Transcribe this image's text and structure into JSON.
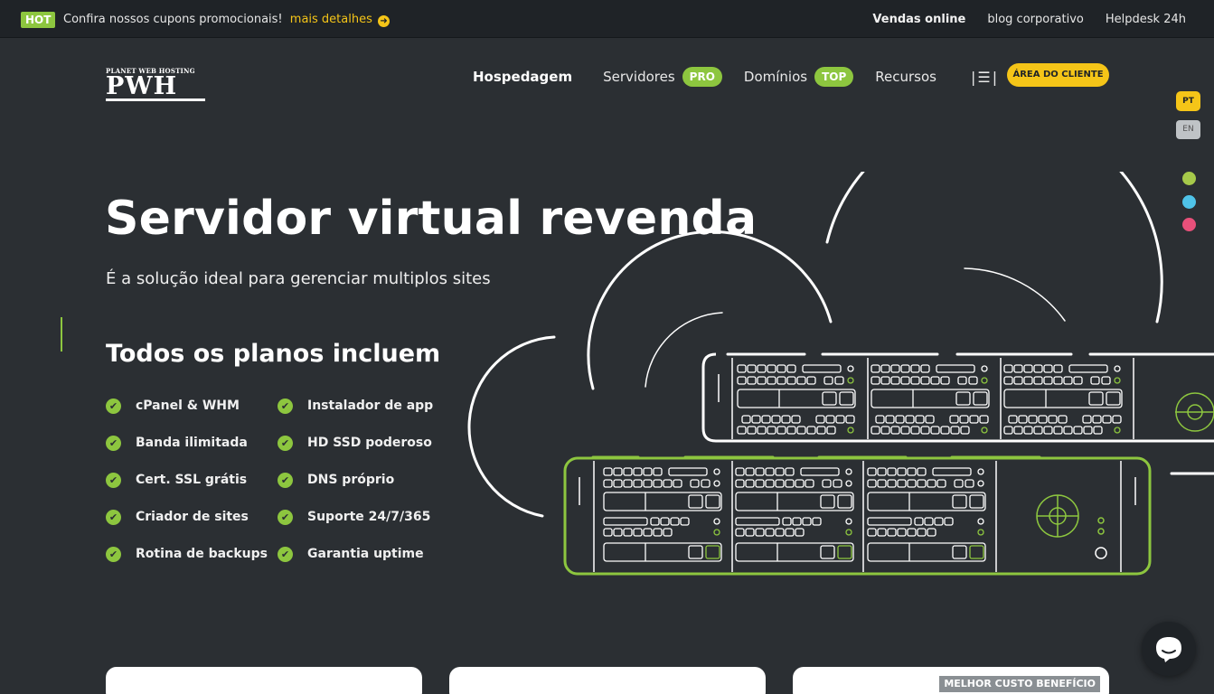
{
  "topbar": {
    "hot_badge": "HOT",
    "promo_text": "Confira nossos cupons promocionais!",
    "promo_link": "mais detalhes",
    "links": [
      "Vendas online",
      "blog corporativo",
      "Helpdesk 24h"
    ]
  },
  "logo": {
    "small": "PLANET WEB HOSTING",
    "big": "PWH"
  },
  "nav": {
    "items": [
      {
        "label": "Hospedagem",
        "badge": ""
      },
      {
        "label": "Servidores",
        "badge": "PRO"
      },
      {
        "label": "Domínios",
        "badge": "TOP"
      },
      {
        "label": "Recursos",
        "badge": ""
      }
    ],
    "client_button": "ÁREA DO CLIENTE"
  },
  "language": {
    "active": "PT",
    "other": "EN"
  },
  "theme_colors": [
    "#a6c94a",
    "#4fc3e8",
    "#e8507a"
  ],
  "hero": {
    "title": "Servidor virtual revenda",
    "subtitle": "É a solução ideal para gerenciar multiplos sites",
    "plans_title": "Todos os planos incluem",
    "features": [
      "cPanel & WHM",
      "Instalador de app",
      "Banda ilimitada",
      "HD SSD poderoso",
      "Cert. SSL grátis",
      "DNS próprio",
      "Criador de sites",
      "Suporte 24/7/365",
      "Rotina de backups",
      "Garantia uptime"
    ]
  },
  "cards": {
    "third_badge": "MELHOR CUSTO BENEFÍCIO"
  },
  "colors": {
    "background": "#2b2f33",
    "topbar": "#1f2327",
    "accent_green": "#8dc63f",
    "accent_yellow": "#f5c518"
  }
}
